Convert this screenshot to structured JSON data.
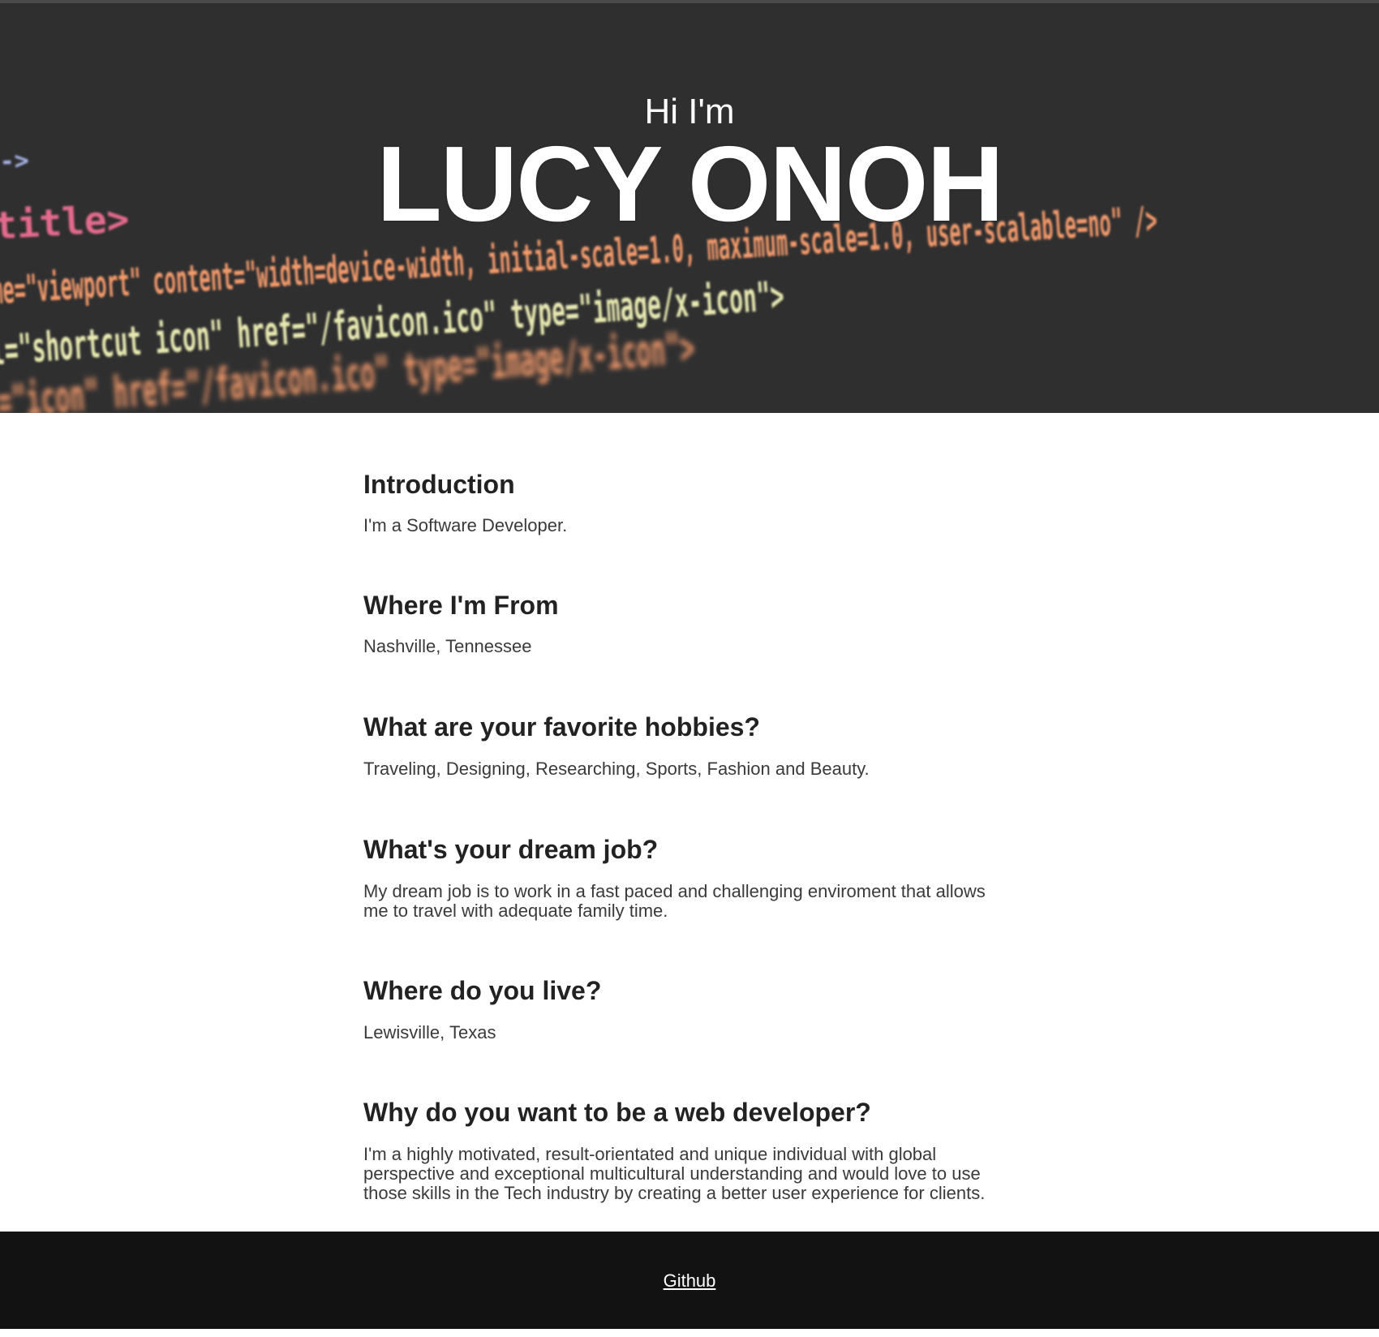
{
  "hero": {
    "greeting": "Hi I'm",
    "name": "LUCY ONOH",
    "code_lines": [
      "->",
      "title>",
      "me=\"viewport\" content=\"width=device-width, initial-scale=1.0, maximum-scale=1.0, user-scalable=no\" />",
      "l=\"shortcut icon\" href=\"/favicon.ico\" type=\"image/x-icon\">",
      "l=\"icon\" href=\"/favicon.ico\" type=\"image/x-icon\">"
    ]
  },
  "sections": [
    {
      "heading": "Introduction",
      "body": "I'm a Software Developer."
    },
    {
      "heading": "Where I'm From",
      "body": "Nashville, Tennessee"
    },
    {
      "heading": "What are your favorite hobbies?",
      "body": "Traveling, Designing, Researching, Sports, Fashion and Beauty."
    },
    {
      "heading": "What's your dream job?",
      "body": "My dream job is to work in a fast paced and challenging enviroment that allows me to travel with adequate family time."
    },
    {
      "heading": "Where do you live?",
      "body": "Lewisville, Texas"
    },
    {
      "heading": "Why do you want to be a web developer?",
      "body": "I'm a highly motivated, result-orientated and unique individual with global perspective and exceptional multicultural understanding and would love to use those skills in the Tech industry by creating a better user experience for clients."
    }
  ],
  "footer": {
    "link_label": "Github"
  },
  "colors": {
    "hero_bg": "#2f2f30",
    "footer_bg": "#121212",
    "heading": "#222222",
    "body_text": "#3a3a3a",
    "code_tag": "#e36a8c",
    "code_attr": "#f39a6a",
    "code_string": "#e8e8b0",
    "code_punct": "#a9b7e8"
  }
}
